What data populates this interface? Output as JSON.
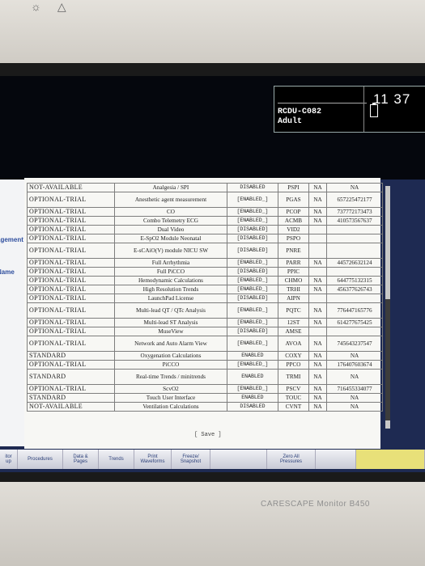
{
  "status": {
    "unit_id": "RCDU-C082",
    "patient_type": "Adult",
    "clock": "11 37"
  },
  "side_labels": [
    "agement",
    "Name"
  ],
  "table": {
    "rows": [
      {
        "trial": "NOT-AVAILABLE",
        "feature": "Analgesia / SPI",
        "state": "DISABLED",
        "code": "PSPI",
        "na": "NA",
        "key": "NA"
      },
      {
        "trial": "OPTIONAL-TRIAL",
        "feature": "Anesthetic agent measurement",
        "state": "[ENABLED_]",
        "code": "PGAS",
        "na": "NA",
        "key": "657225472177"
      },
      {
        "trial": "OPTIONAL-TRIAL",
        "feature": "CO",
        "state": "[ENABLED_]",
        "code": "PCOP",
        "na": "NA",
        "key": "737772173473"
      },
      {
        "trial": "OPTIONAL-TRIAL",
        "feature": "Combo Telemetry ECG",
        "state": "[ENABLED_]",
        "code": "ACMB",
        "na": "NA",
        "key": "410573567637"
      },
      {
        "trial": "OPTIONAL-TRIAL",
        "feature": "Dual Video",
        "state": "[DISABLED]",
        "code": "VID2",
        "na": "",
        "key": ""
      },
      {
        "trial": "OPTIONAL-TRIAL",
        "feature": "E-SpO2 Module Neonatal",
        "state": "[DISABLED]",
        "code": "PSPO",
        "na": "",
        "key": ""
      },
      {
        "trial": "OPTIONAL-TRIAL",
        "feature": "E-sCAiO(V) module NICU SW",
        "state": "[DISABLED]",
        "code": "PNRE",
        "na": "",
        "key": ""
      },
      {
        "trial": "OPTIONAL-TRIAL",
        "feature": "Full Arrhythmia",
        "state": "[ENABLED_]",
        "code": "PARR",
        "na": "NA",
        "key": "445726632124"
      },
      {
        "trial": "OPTIONAL-TRIAL",
        "feature": "Full PiCCO",
        "state": "[DISABLED]",
        "code": "PPIC",
        "na": "",
        "key": ""
      },
      {
        "trial": "OPTIONAL-TRIAL",
        "feature": "Hemodynamic Calculations",
        "state": "[ENABLED_]",
        "code": "CHMO",
        "na": "NA",
        "key": "644775132315"
      },
      {
        "trial": "OPTIONAL-TRIAL",
        "feature": "High Resolution Trends",
        "state": "[ENABLED_]",
        "code": "TRHI",
        "na": "NA",
        "key": "456377626743"
      },
      {
        "trial": "OPTIONAL-TRIAL",
        "feature": "LaunchPad License",
        "state": "[DISABLED]",
        "code": "AIPN",
        "na": "",
        "key": ""
      },
      {
        "trial": "OPTIONAL-TRIAL",
        "feature": "Multi-lead QT / QTc Analysis",
        "state": "[ENABLED_]",
        "code": "PQTC",
        "na": "NA",
        "key": "776447165776"
      },
      {
        "trial": "OPTIONAL-TRIAL",
        "feature": "Multi-lead ST Analysis",
        "state": "[ENABLED_]",
        "code": "12ST",
        "na": "NA",
        "key": "614277675425"
      },
      {
        "trial": "OPTIONAL-TRIAL",
        "feature": "MuseView",
        "state": "[DISABLED]",
        "code": "AMSE",
        "na": "",
        "key": ""
      },
      {
        "trial": "OPTIONAL-TRIAL",
        "feature": "Network and Auto Alarm View",
        "state": "[ENABLED_]",
        "code": "AVOA",
        "na": "NA",
        "key": "745643237547"
      },
      {
        "trial": "STANDARD",
        "feature": "Oxygenation Calculations",
        "state": "ENABLED",
        "code": "COXY",
        "na": "NA",
        "key": "NA"
      },
      {
        "trial": "OPTIONAL-TRIAL",
        "feature": "PiCCO",
        "state": "[ENABLED_]",
        "code": "PPCO",
        "na": "NA",
        "key": "176407603674"
      },
      {
        "trial": "STANDARD",
        "feature": "Real-time Trends / minitrends",
        "state": "ENABLED",
        "code": "TRMI",
        "na": "NA",
        "key": "NA"
      },
      {
        "trial": "OPTIONAL-TRIAL",
        "feature": "ScvO2",
        "state": "[ENABLED_]",
        "code": "PSCV",
        "na": "NA",
        "key": "716455334077"
      },
      {
        "trial": "STANDARD",
        "feature": "Touch User Interface",
        "state": "ENABLED",
        "code": "TOUC",
        "na": "NA",
        "key": "NA"
      },
      {
        "trial": "NOT-AVAILABLE",
        "feature": "Ventilation Calculations",
        "state": "DISABLED",
        "code": "CVNT",
        "na": "NA",
        "key": "NA"
      }
    ],
    "save_label": "[ Save ]"
  },
  "keys": [
    {
      "label": "itor\nup",
      "w": 22
    },
    {
      "label": "Procedures",
      "w": 56
    },
    {
      "label": "Data &\nPages",
      "w": 44
    },
    {
      "label": "Trends",
      "w": 44
    },
    {
      "label": "Print\nWaveforms",
      "w": 46
    },
    {
      "label": "Freeze/\nSnapshot",
      "w": 48
    },
    {
      "label": "",
      "w": 70
    },
    {
      "label": "Zero All\nPressures",
      "w": 60
    },
    {
      "label": "",
      "w": 50
    },
    {
      "label": "",
      "w": 85
    }
  ],
  "brand": "CARESCAPE Monitor B450"
}
